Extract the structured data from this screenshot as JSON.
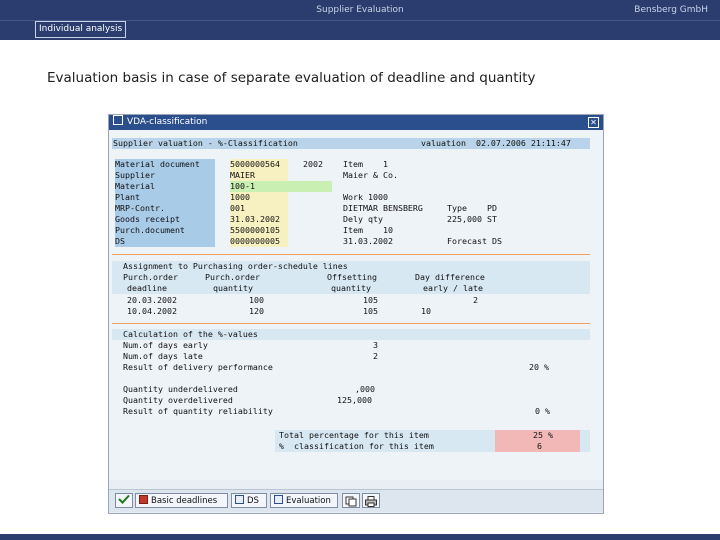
{
  "slide": {
    "header_center": "Supplier Evaluation",
    "brand": "Bensberg GmbH",
    "section_tab": "Individual analysis",
    "heading": "Evaluation basis in case of separate evaluation of deadline and quantity"
  },
  "window": {
    "title": "VDA-classification",
    "close_glyph": "✕",
    "top_line_left": "Supplier valuation - %-Classification",
    "top_line_right": "valuation  02.07.2006 21:11:47"
  },
  "fields": [
    {
      "label": "Material document",
      "value": "5000000564",
      "extra": "2002",
      "extra2": "Item    1"
    },
    {
      "label": "Supplier",
      "value": "MAIER",
      "extra2": "Maier & Co."
    },
    {
      "label": "Material",
      "value": "100-1"
    },
    {
      "label": "Plant",
      "value": "1000",
      "extra2": "Work 1000"
    },
    {
      "label": "MRP-Contr.",
      "value": "001",
      "extra2": "DIETMAR BENSBERG",
      "extra3": "Type    PD"
    },
    {
      "label": "Goods receipt",
      "value": "31.03.2002",
      "extra2": "Dely qty",
      "extra3": "225,000 ST"
    },
    {
      "label": "Purch.document",
      "value": "5500000105",
      "extra2": "Item    10"
    },
    {
      "label": "DS",
      "value": "0000000005",
      "extra2": "31.03.2002",
      "extra3": "Forecast DS"
    }
  ],
  "assignment": {
    "title": "Assignment to Purchasing order-schedule lines",
    "col1_h1": "Purch.order",
    "col1_h2": "deadline",
    "col2_h1": "Purch.order",
    "col2_h2": "quantity",
    "col3_h1": "Offsetting",
    "col3_h2": "quantity",
    "col4_h1": "Day difference",
    "col4_h2": "early / late",
    "rows": [
      {
        "date": "20.03.2002",
        "qty": "100",
        "offset": "105",
        "diff": "2"
      },
      {
        "date": "10.04.2002",
        "qty": "120",
        "offset": "105",
        "diff": "10"
      }
    ]
  },
  "calc": {
    "title": "Calculation of the %-values",
    "rows": [
      {
        "label": "Num.of days early",
        "value": "3"
      },
      {
        "label": "Num.of days late",
        "value": "2"
      },
      {
        "label": "Result of delivery performance",
        "value": "20 %"
      },
      {
        "label": "Quantity underdelivered",
        "value": ",000"
      },
      {
        "label": "Quantity overdelivered",
        "value": "125,000"
      },
      {
        "label": "Result of quantity reliability",
        "value": "0 %"
      }
    ]
  },
  "total": {
    "row1_label": "Total percentage for this item",
    "row1_value": "25 %",
    "row2_label": "%  classification for this item",
    "row2_value": "6"
  },
  "toolbar": {
    "basic_deadlines": "Basic deadlines",
    "ds": "DS",
    "evaluation": "Evaluation"
  }
}
